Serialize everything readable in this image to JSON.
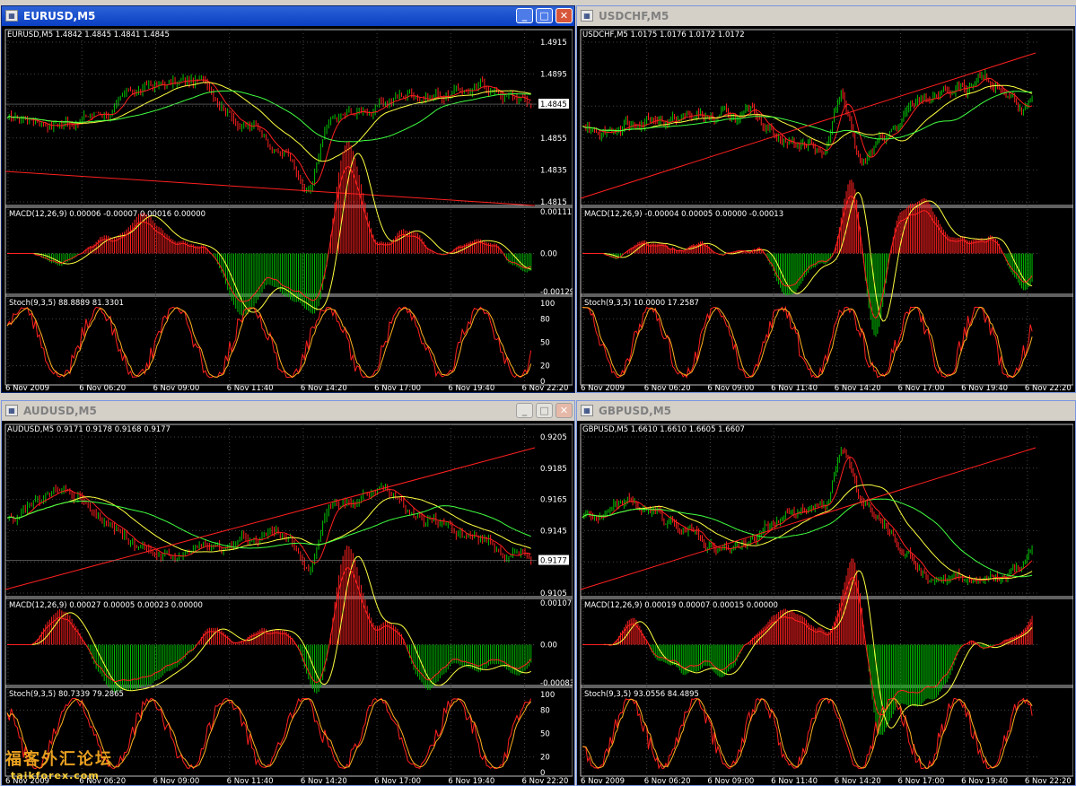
{
  "windows": [
    {
      "title": "EURUSD,M5",
      "active": true,
      "header": "EURUSD,M5  1.4842 1.4845 1.4841 1.4845",
      "price_labels": [
        "1.4915",
        "1.4895",
        "1.4875",
        "1.4855",
        "1.4835",
        "1.4815"
      ],
      "current_price": "1.4845",
      "macd_header": "MACD(12,26,9) 0.00006 -0.00007 0.00016 0.00000",
      "macd_labels": [
        "0.00111",
        "0.00",
        "-0.00129"
      ],
      "stoch_header": "Stoch(9,3,5) 88.8889 81.3301",
      "stoch_labels": [
        "100",
        "80",
        "50",
        "20",
        "0"
      ],
      "time_labels": [
        "6 Nov 2009",
        "6 Nov 06:20",
        "6 Nov 09:00",
        "6 Nov 11:40",
        "6 Nov 14:20",
        "6 Nov 17:00",
        "6 Nov 19:40",
        "6 Nov 22:20"
      ]
    },
    {
      "title": "USDCHF,M5",
      "active": false,
      "header": "USDCHF,M5  1.0175 1.0176 1.0172 1.0172",
      "price_labels": [],
      "current_price": "",
      "macd_header": "MACD(12,26,9) -0.00004 0.00005 0.00000 -0.00013",
      "macd_labels": [],
      "stoch_header": "Stoch(9,3,5) 10.0000 17.2587",
      "stoch_labels": [],
      "time_labels": [
        "6 Nov 2009",
        "6 Nov 06:20",
        "6 Nov 09:00",
        "6 Nov 11:40",
        "6 Nov 14:20",
        "6 Nov 17:00",
        "6 Nov 19:40",
        "6 Nov 22:20"
      ]
    },
    {
      "title": "AUDUSD,M5",
      "active": false,
      "header": "AUDUSD,M5  0.9171 0.9178 0.9168 0.9177",
      "price_labels": [
        "0.9205",
        "0.9185",
        "0.9165",
        "0.9145",
        "0.9125",
        "0.9105"
      ],
      "current_price": "0.9177",
      "macd_header": "MACD(12,26,9) 0.00027 0.00005 0.00023 0.00000",
      "macd_labels": [
        "0.00107",
        "0.00",
        "-0.00083"
      ],
      "stoch_header": "Stoch(9,3,5) 80.7339 79.2865",
      "stoch_labels": [
        "100",
        "80",
        "50",
        "20",
        "0"
      ],
      "time_labels": [
        "6 Nov 2009",
        "6 Nov 06:20",
        "6 Nov 09:00",
        "6 Nov 11:40",
        "6 Nov 14:20",
        "6 Nov 17:00",
        "6 Nov 19:40",
        "6 Nov 22:20"
      ]
    },
    {
      "title": "GBPUSD,M5",
      "active": false,
      "header": "GBPUSD,M5  1.6610 1.6610 1.6605 1.6607",
      "price_labels": [],
      "current_price": "",
      "macd_header": "MACD(12,26,9) 0.00019 0.00007 0.00015 0.00000",
      "macd_labels": [],
      "stoch_header": "Stoch(9,3,5) 93.0556 84.4895",
      "stoch_labels": [],
      "time_labels": [
        "6 Nov 2009",
        "6 Nov 06:20",
        "6 Nov 09:00",
        "6 Nov 11:40",
        "6 Nov 14:20",
        "6 Nov 17:00",
        "6 Nov 19:40",
        "6 Nov 22:20"
      ]
    }
  ],
  "watermark": {
    "top": "福客外汇论坛",
    "bottom": "taikforex.com"
  },
  "colors": {
    "bull": "#00c000",
    "bear": "#ff2020",
    "ma_fast": "#ff2020",
    "ma_mid": "#ffff40",
    "ma_slow": "#40ff40",
    "grid": "#444444",
    "signal": "#ffff40"
  }
}
